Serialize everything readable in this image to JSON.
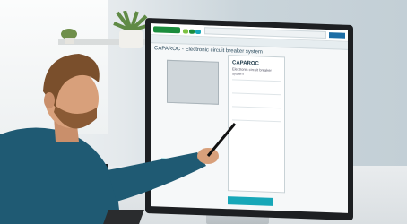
{
  "scene": {
    "description_colors": {
      "shirt": "#1f5a73",
      "screen_accent": "#17a7b8",
      "brand_green": "#1a8c3c"
    }
  },
  "screen": {
    "page_title": "CAPAROC - Electronic circuit breaker system",
    "panel_title": "CAPAROC",
    "panel_subtitle": "Electronic circuit breaker system"
  }
}
